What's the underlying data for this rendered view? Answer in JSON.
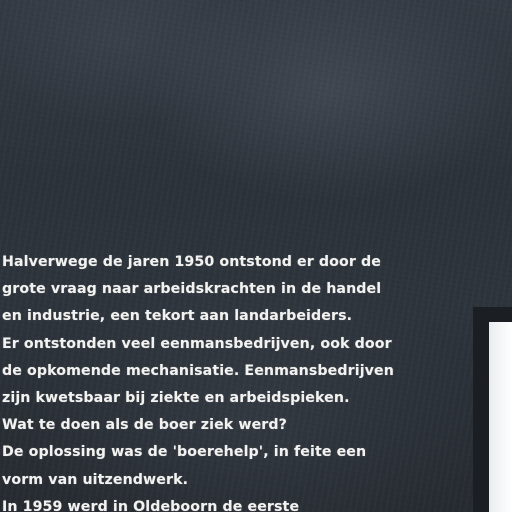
{
  "panel": {
    "lines": [
      "Halverwege de jaren 1950 ontstond er door de",
      "grote vraag naar arbeidskrachten in de handel",
      "en industrie, een tekort aan landarbeiders.",
      "Er ontstonden veel eenmansbedrijven, ook door",
      "de opkomende mechanisatie. Eenmansbedrijven",
      "zijn kwetsbaar bij ziekte en arbeidspieken.",
      "Wat te doen als de boer ziek werd?",
      "De oplossing was de 'boerehelp', in feite een",
      "vorm van uitzendwerk.",
      "In 1959 werd in Oldeboorn de eerste"
    ]
  },
  "colors": {
    "board": "#2e343c",
    "text": "#f2f2f0",
    "frame": "#1b1f24",
    "sheet": "#f7f8f9"
  }
}
